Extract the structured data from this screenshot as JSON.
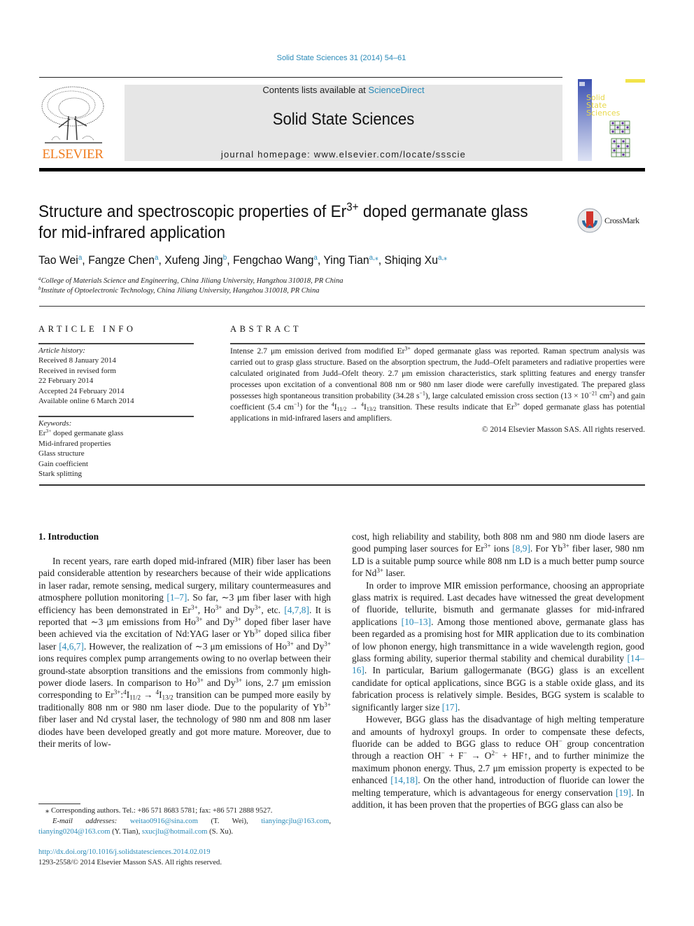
{
  "journal_ref": "Solid State Sciences 31 (2014) 54–61",
  "header": {
    "contents_prefix": "Contents lists available at ",
    "contents_link": "ScienceDirect",
    "journal_title": "Solid State Sciences",
    "homepage": "journal homepage: www.elsevier.com/locate/ssscie",
    "publisher_logo": "ELSEVIER",
    "cover_title_lines": [
      "Solid",
      "State",
      "Sciences"
    ]
  },
  "crossmark_label": "CrossMark",
  "colors": {
    "link": "#2a8ab8",
    "elsevier_orange": "#f07c1e",
    "header_bg": "#e6e6e6",
    "cover_blue": "#3a4fb0",
    "cover_yellow": "#f2e34a"
  },
  "title": [
    {
      "t": "Structure and spectroscopic properties of Er"
    },
    {
      "t": "3+",
      "f": "sup"
    },
    {
      "t": " doped germanate glass"
    },
    {
      "t": "",
      "f": "br"
    },
    {
      "t": "for mid-infrared application"
    }
  ],
  "authors": [
    {
      "t": "Tao Wei"
    },
    {
      "t": "a",
      "f": "sup"
    },
    {
      "t": ", Fangze Chen"
    },
    {
      "t": "a",
      "f": "sup"
    },
    {
      "t": ", Xufeng Jing"
    },
    {
      "t": "b",
      "f": "sup"
    },
    {
      "t": ", Fengchao Wang"
    },
    {
      "t": "a",
      "f": "sup"
    },
    {
      "t": ", Ying Tian"
    },
    {
      "t": "a,⁎",
      "f": "sup"
    },
    {
      "t": ", Shiqing Xu"
    },
    {
      "t": "a,⁎",
      "f": "sup"
    }
  ],
  "affiliations": [
    {
      "mark": "a",
      "text": "College of Materials Science and Engineering, China Jiliang University, Hangzhou 310018, PR China"
    },
    {
      "mark": "b",
      "text": "Institute of Optoelectronic Technology, China Jiliang University, Hangzhou 310018, PR China"
    }
  ],
  "article_info": {
    "heading": "ARTICLE INFO",
    "history_label": "Article history:",
    "history": [
      "Received 8 January 2014",
      "Received in revised form",
      "22 February 2014",
      "Accepted 24 February 2014",
      "Available online 6 March 2014"
    ],
    "keywords_label": "Keywords:",
    "keywords": [
      [
        {
          "t": "Er"
        },
        {
          "t": "3+",
          "f": "sup"
        },
        {
          "t": " doped germanate glass"
        }
      ],
      [
        {
          "t": "Mid-infrared properties"
        }
      ],
      [
        {
          "t": "Glass structure"
        }
      ],
      [
        {
          "t": "Gain coefficient"
        }
      ],
      [
        {
          "t": "Stark splitting"
        }
      ]
    ]
  },
  "abstract": {
    "heading": "ABSTRACT",
    "body": [
      {
        "t": "Intense 2.7 μm emission derived from modified Er"
      },
      {
        "t": "3+",
        "f": "sup"
      },
      {
        "t": " doped germanate glass was reported. Raman spectrum analysis was carried out to grasp glass structure. Based on the absorption spectrum, the Judd–Ofelt parameters and radiative properties were calculated originated from Judd–Ofelt theory. 2.7 μm emission characteristics, stark splitting features and energy transfer processes upon excitation of a conventional 808 nm or 980 nm laser diode were carefully investigated. The prepared glass possesses high spontaneous transition probability (34.28 s"
      },
      {
        "t": "−1",
        "f": "sup"
      },
      {
        "t": "), large calculated emission cross section (13 × 10"
      },
      {
        "t": "−21",
        "f": "sup"
      },
      {
        "t": " cm"
      },
      {
        "t": "2",
        "f": "sup"
      },
      {
        "t": ") and gain coefficient (5.4 cm"
      },
      {
        "t": "−1",
        "f": "sup"
      },
      {
        "t": ") for the "
      },
      {
        "t": "4",
        "f": "sup"
      },
      {
        "t": "I"
      },
      {
        "t": "11/2",
        "f": "sub"
      },
      {
        "t": " → "
      },
      {
        "t": "4",
        "f": "sup"
      },
      {
        "t": "I"
      },
      {
        "t": "13/2",
        "f": "sub"
      },
      {
        "t": " transition. These results indicate that Er"
      },
      {
        "t": "3+",
        "f": "sup"
      },
      {
        "t": " doped germanate glass has potential applications in mid-infrared lasers and amplifiers."
      }
    ],
    "copyright": "© 2014 Elsevier Masson SAS. All rights reserved."
  },
  "introduction": {
    "heading": "1.  Introduction",
    "left_paragraphs": [
      [
        {
          "t": "In recent years, rare earth doped mid-infrared (MIR) fiber laser has been paid considerable attention by researchers because of their wide applications in laser radar, remote sensing, medical surgery, military countermeasures and atmosphere pollution monitoring "
        },
        {
          "t": "[1–7]",
          "f": "link"
        },
        {
          "t": ". So far, ∼3 μm fiber laser with high efficiency has been demonstrated in Er"
        },
        {
          "t": "3+",
          "f": "sup"
        },
        {
          "t": ", Ho"
        },
        {
          "t": "3+",
          "f": "sup"
        },
        {
          "t": " and Dy"
        },
        {
          "t": "3+",
          "f": "sup"
        },
        {
          "t": ", etc. "
        },
        {
          "t": "[4,7,8]",
          "f": "link"
        },
        {
          "t": ". It is reported that ∼3 μm emissions from Ho"
        },
        {
          "t": "3+",
          "f": "sup"
        },
        {
          "t": " and Dy"
        },
        {
          "t": "3+",
          "f": "sup"
        },
        {
          "t": " doped fiber laser have been achieved via the excitation of Nd:YAG laser or Yb"
        },
        {
          "t": "3+",
          "f": "sup"
        },
        {
          "t": " doped silica fiber laser "
        },
        {
          "t": "[4,6,7]",
          "f": "link"
        },
        {
          "t": ". However, the realization of ∼3 μm emissions of Ho"
        },
        {
          "t": "3+",
          "f": "sup"
        },
        {
          "t": " and Dy"
        },
        {
          "t": "3+",
          "f": "sup"
        },
        {
          "t": " ions requires complex pump arrangements owing to no overlap between their ground-state absorption transitions and the emissions from commonly high-power diode lasers. In comparison to Ho"
        },
        {
          "t": "3+",
          "f": "sup"
        },
        {
          "t": " and Dy"
        },
        {
          "t": "3+",
          "f": "sup"
        },
        {
          "t": " ions, 2.7 μm emission corresponding to Er"
        },
        {
          "t": "3+",
          "f": "sup"
        },
        {
          "t": ":"
        },
        {
          "t": "4",
          "f": "sup"
        },
        {
          "t": "I"
        },
        {
          "t": "11/2",
          "f": "sub"
        },
        {
          "t": " → "
        },
        {
          "t": "4",
          "f": "sup"
        },
        {
          "t": "I"
        },
        {
          "t": "13/2",
          "f": "sub"
        },
        {
          "t": " transition can be pumped more easily by traditionally 808 nm or 980 nm laser diode. Due to the popularity of Yb"
        },
        {
          "t": "3+",
          "f": "sup"
        },
        {
          "t": " fiber laser and Nd crystal laser, the technology of 980 nm and 808 nm laser diodes have been developed greatly and got more mature. Moreover, due to their merits of low-"
        }
      ]
    ],
    "right_paragraphs": [
      [
        {
          "t": "cost, high reliability and stability, both 808 nm and 980 nm diode lasers are good pumping laser sources for Er"
        },
        {
          "t": "3+",
          "f": "sup"
        },
        {
          "t": " ions "
        },
        {
          "t": "[8,9]",
          "f": "link"
        },
        {
          "t": ". For Yb"
        },
        {
          "t": "3+",
          "f": "sup"
        },
        {
          "t": " fiber laser, 980 nm LD is a suitable pump source while 808 nm LD is a much better pump source for Nd"
        },
        {
          "t": "3+",
          "f": "sup"
        },
        {
          "t": " laser."
        }
      ],
      [
        {
          "t": "In order to improve MIR emission performance, choosing an appropriate glass matrix is required. Last decades have witnessed the great development of fluoride, tellurite, bismuth and germanate glasses for mid-infrared applications "
        },
        {
          "t": "[10–13]",
          "f": "link"
        },
        {
          "t": ". Among those mentioned above, germanate glass has been regarded as a promising host for MIR application due to its combination of low phonon energy, high transmittance in a wide wavelength region, good glass forming ability, superior thermal stability and chemical durability "
        },
        {
          "t": "[14–16]",
          "f": "link"
        },
        {
          "t": ". In particular, Barium gallogermanate (BGG) glass is an excellent candidate for optical applications, since BGG is a stable oxide glass, and its fabrication process is relatively simple. Besides, BGG system is scalable to significantly larger size "
        },
        {
          "t": "[17]",
          "f": "link"
        },
        {
          "t": "."
        }
      ],
      [
        {
          "t": "However, BGG glass has the disadvantage of high melting temperature and amounts of hydroxyl groups. In order to compensate these defects, fluoride can be added to BGG glass to reduce OH"
        },
        {
          "t": "−",
          "f": "sup"
        },
        {
          "t": " group concentration through a reaction OH"
        },
        {
          "t": "−",
          "f": "sup"
        },
        {
          "t": " + F"
        },
        {
          "t": "−",
          "f": "sup"
        },
        {
          "t": " → O"
        },
        {
          "t": "2−",
          "f": "sup"
        },
        {
          "t": " + HF↑, and to further minimize the maximum phonon energy. Thus, 2.7 μm emission property is expected to be enhanced "
        },
        {
          "t": "[14,18]",
          "f": "link"
        },
        {
          "t": ". On the other hand, introduction of fluoride can lower the melting temperature, which is advantageous for energy conservation "
        },
        {
          "t": "[19]",
          "f": "link"
        },
        {
          "t": ". In addition, it has been proven that the properties of BGG glass can also be"
        }
      ]
    ]
  },
  "footnote": {
    "corresponding": "⁎ Corresponding authors. Tel.: +86 571 8683 5781; fax: +86 571 2888 9527.",
    "email_label": "E-mail addresses: ",
    "emails": [
      {
        "addr": "weitao0916@sina.com",
        "who": " (T. Wei), "
      },
      {
        "addr": "tianyingcjlu@163.com",
        "who": ", "
      },
      {
        "addr": "tianying0204@163.com",
        "who": " (Y. Tian), "
      },
      {
        "addr": "sxucjlu@hotmail.com",
        "who": " (S. Xu)."
      }
    ]
  },
  "doi": "http://dx.doi.org/10.1016/j.solidstatesciences.2014.02.019",
  "issn_line": "1293-2558/© 2014 Elsevier Masson SAS. All rights reserved."
}
